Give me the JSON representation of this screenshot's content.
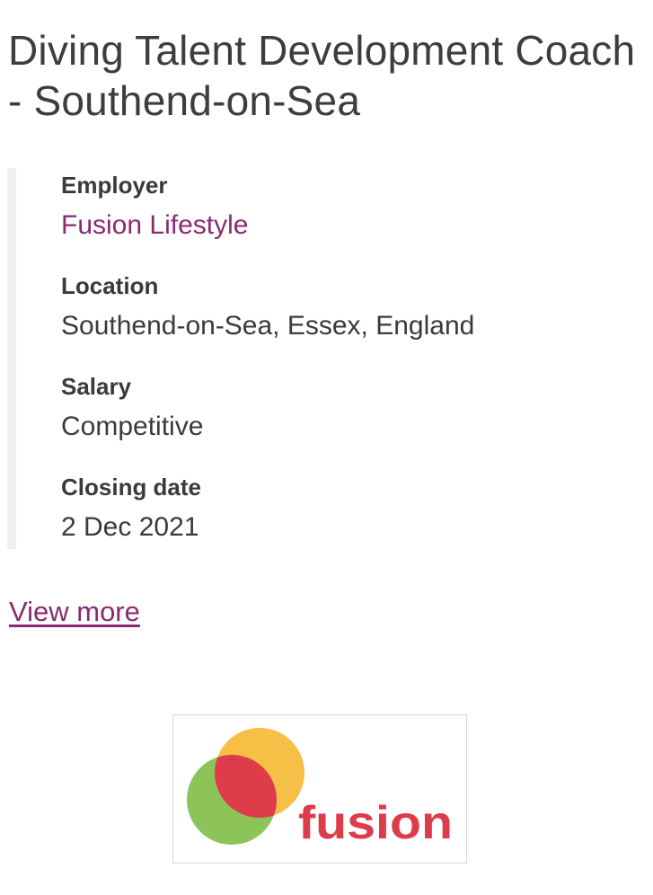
{
  "job": {
    "title": "Diving Talent Development Coach - Southend-on-Sea"
  },
  "details": {
    "employer_label": "Employer",
    "employer_value": "Fusion Lifestyle",
    "location_label": "Location",
    "location_value": "Southend-on-Sea, Essex, England",
    "salary_label": "Salary",
    "salary_value": "Competitive",
    "closing_label": "Closing date",
    "closing_value": "2 Dec 2021"
  },
  "actions": {
    "view_more": "View more"
  },
  "logo": {
    "wordmark": "fusion",
    "colors": {
      "yellow": "#f6bf45",
      "green": "#8cc45a",
      "red": "#df3c4b"
    }
  },
  "colors": {
    "link": "#8a2a72",
    "text": "#3a3a3a",
    "rule": "#efefef"
  }
}
